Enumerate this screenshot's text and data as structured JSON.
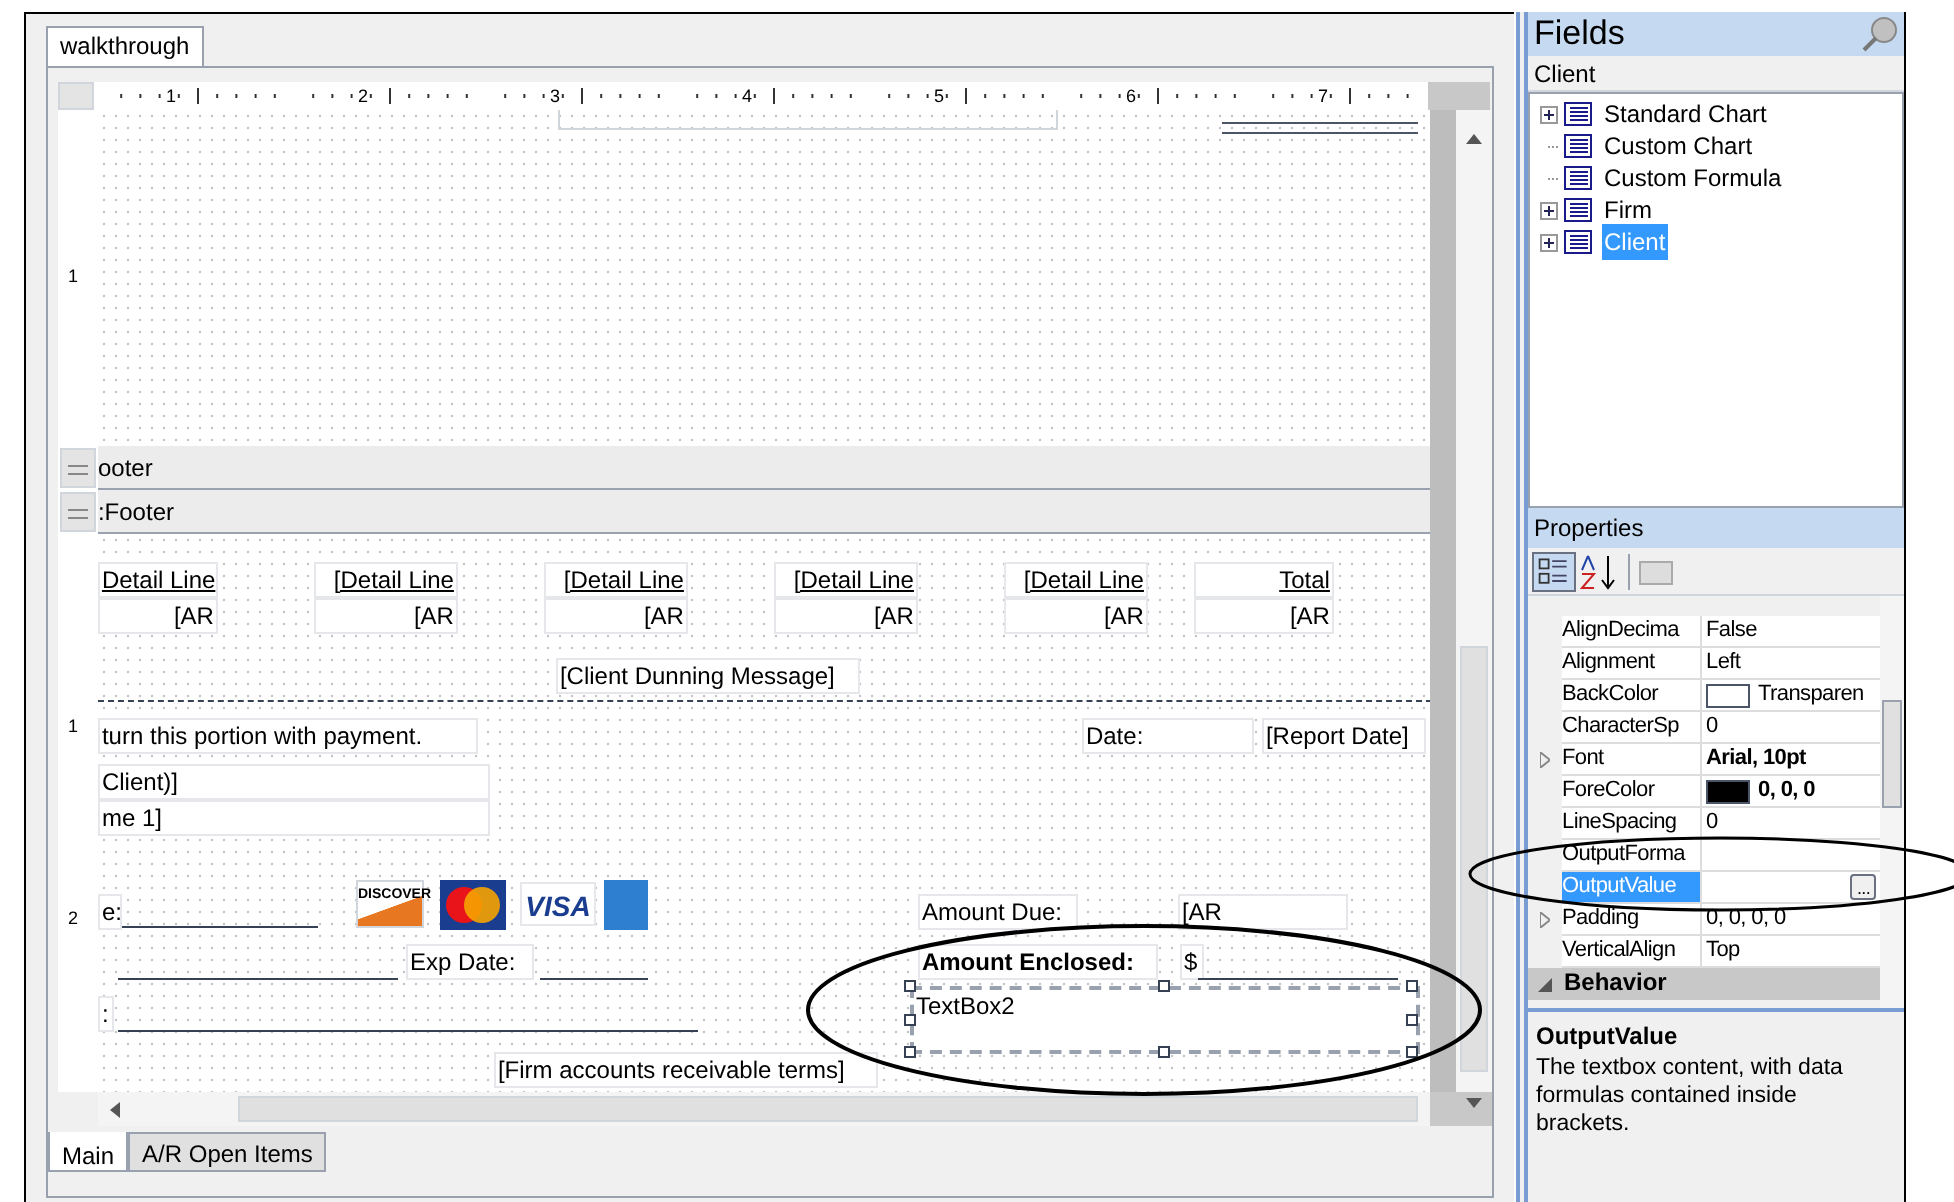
{
  "document_tab": {
    "label": "walkthrough",
    "selected": true
  },
  "ruler": {
    "labels": [
      "1",
      "2",
      "3",
      "4",
      "5",
      "6",
      "7"
    ]
  },
  "vertical_ruler": {
    "labels": [
      "1",
      "1",
      "2"
    ]
  },
  "bands": [
    {
      "label": "ooter"
    },
    {
      "label": ":Footer"
    }
  ],
  "canvas": {
    "controls": [
      {
        "kind": "header",
        "text": "Detail Line"
      },
      {
        "kind": "header",
        "text": "[Detail Line"
      },
      {
        "kind": "header",
        "text": "[Detail Line"
      },
      {
        "kind": "header",
        "text": "[Detail Line"
      },
      {
        "kind": "header",
        "text": "[Detail Line"
      },
      {
        "kind": "header",
        "text": "Total"
      },
      {
        "kind": "value",
        "text": "[AR"
      },
      {
        "kind": "value",
        "text": "[AR"
      },
      {
        "kind": "value",
        "text": "[AR"
      },
      {
        "kind": "value",
        "text": "[AR"
      },
      {
        "kind": "value",
        "text": "[AR"
      },
      {
        "kind": "value",
        "text": "[AR"
      },
      {
        "kind": "label",
        "text": "[Client Dunning Message]"
      },
      {
        "kind": "label",
        "text": "turn this portion with payment."
      },
      {
        "kind": "label",
        "text": "Date:"
      },
      {
        "kind": "label",
        "text": "[Report Date]"
      },
      {
        "kind": "label",
        "text": "Client)]"
      },
      {
        "kind": "label",
        "text": "me 1]"
      },
      {
        "kind": "label",
        "text": "e:"
      },
      {
        "kind": "label",
        "text": "Amount Due:"
      },
      {
        "kind": "label",
        "text": "[AR"
      },
      {
        "kind": "label",
        "text": "Exp Date:"
      },
      {
        "kind": "bold",
        "text": "Amount Enclosed:"
      },
      {
        "kind": "label",
        "text": "$"
      },
      {
        "kind": "label",
        "text": ":"
      },
      {
        "kind": "selected",
        "text": "TextBox2"
      },
      {
        "kind": "label",
        "text": "[Firm accounts receivable terms]"
      }
    ],
    "card_logos": [
      {
        "kind": "discover",
        "text": "DISCOVER"
      },
      {
        "kind": "mastercard"
      },
      {
        "kind": "visa",
        "text": "VISA"
      },
      {
        "kind": "amex"
      }
    ]
  },
  "bottom_tabs": [
    {
      "label": "Main",
      "selected": true
    },
    {
      "label": "A/R Open Items",
      "selected": false
    }
  ],
  "fields_panel": {
    "title": "Fields",
    "subtitle": "Client",
    "tree": [
      {
        "label": "Standard Chart",
        "expandable": true,
        "selected": false
      },
      {
        "label": "Custom Chart",
        "expandable": false,
        "selected": false
      },
      {
        "label": "Custom Formula",
        "expandable": false,
        "selected": false
      },
      {
        "label": "Firm",
        "expandable": true,
        "selected": false
      },
      {
        "label": "Client",
        "expandable": true,
        "selected": true
      }
    ]
  },
  "properties_panel": {
    "title": "Properties",
    "rows": [
      {
        "kind": "property",
        "name": "AlignDecima",
        "value": "False",
        "selected": false
      },
      {
        "kind": "property",
        "name": "Alignment",
        "value": "Left",
        "selected": false
      },
      {
        "kind": "color",
        "name": "BackColor",
        "value": "Transparen",
        "color": "#ffffff",
        "selected": false
      },
      {
        "kind": "property",
        "name": "CharacterSp",
        "value": "0",
        "selected": false
      },
      {
        "kind": "bold",
        "name": "Font",
        "value": "Arial, 10pt",
        "expandable": true,
        "selected": false
      },
      {
        "kind": "color",
        "name": "ForeColor",
        "value": "0, 0, 0",
        "color": "#000000",
        "bold": true,
        "selected": false
      },
      {
        "kind": "property",
        "name": "LineSpacing",
        "value": "0",
        "selected": false
      },
      {
        "kind": "property",
        "name": "OutputForma",
        "selected": false
      },
      {
        "kind": "ellipsis",
        "name": "OutputValue",
        "value": "...",
        "selected": true
      },
      {
        "kind": "property",
        "name": "Padding",
        "value": "0, 0, 0, 0",
        "expandable": true,
        "selected": false
      },
      {
        "kind": "property",
        "name": "VerticalAlign",
        "value": "Top",
        "selected": false
      },
      {
        "kind": "category",
        "name": "Behavior",
        "selected": false
      }
    ],
    "description": {
      "title": "OutputValue",
      "text": "The textbox content, with data formulas contained inside brackets."
    }
  }
}
